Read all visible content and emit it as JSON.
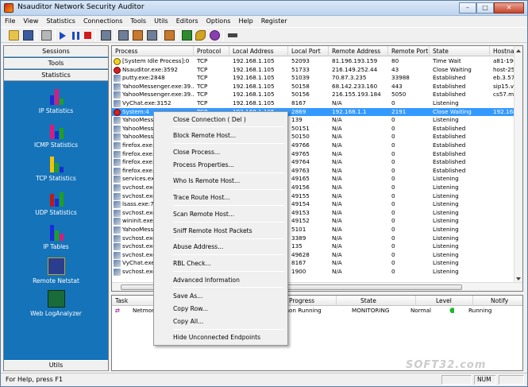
{
  "window": {
    "title": "Nsauditor Network Security Auditor",
    "buttons": [
      "–",
      "□",
      "✕"
    ]
  },
  "menu": [
    "File",
    "View",
    "Statistics",
    "Connections",
    "Tools",
    "Utils",
    "Editors",
    "Options",
    "Help",
    "Register"
  ],
  "left": {
    "tabs": {
      "sessions": "Sessions",
      "tools": "Tools",
      "statistics": "Statistics",
      "utils": "Utils"
    },
    "items": [
      {
        "label": "IP Statistics",
        "icon": "ip-statistics-icon"
      },
      {
        "label": "ICMP Statistics",
        "icon": "icmp-statistics-icon"
      },
      {
        "label": "TCP Statistics",
        "icon": "tcp-statistics-icon"
      },
      {
        "label": "UDP Statistics",
        "icon": "udp-statistics-icon"
      },
      {
        "label": "IP Tables",
        "icon": "ip-tables-icon"
      },
      {
        "label": "Remote Netstat",
        "icon": "remote-netstat-icon"
      },
      {
        "label": "Web LogAnalyzer",
        "icon": "web-loganalyzer-icon"
      }
    ]
  },
  "table": {
    "columns": [
      "Process",
      "Protocol",
      "Local Address",
      "Local Port",
      "Remote Address",
      "Remote Port",
      "State",
      "Hostnam"
    ],
    "rows": [
      [
        "[System Idle Process]:0",
        "TCP",
        "192.168.1.105",
        "52093",
        "81.196.193.159",
        "80",
        "Time Wait",
        "a81-196"
      ],
      [
        "Nsauditor.exe:3592",
        "TCP",
        "192.168.1.105",
        "51733",
        "216.149.252.44",
        "43",
        "Close Waiting",
        "host-252"
      ],
      [
        "putty.exe:2848",
        "TCP",
        "192.168.1.105",
        "51039",
        "70.87.3.235",
        "33988",
        "Established",
        "eb.3.574"
      ],
      [
        "YahooMessenger.exe:39...",
        "TCP",
        "192.168.1.105",
        "50158",
        "68.142.233.160",
        "443",
        "Established",
        "sip15.vo"
      ],
      [
        "YahooMessenger.exe:39...",
        "TCP",
        "192.168.1.105",
        "50156",
        "216.155.193.184",
        "5050",
        "Established",
        "cs57.ms"
      ],
      [
        "VyChat.exe:3152",
        "TCP",
        "192.168.1.105",
        "8167",
        "N/A",
        "0",
        "Listening",
        ""
      ],
      [
        "System:4",
        "TCP",
        "192.168.1.105",
        "2869",
        "192.168.1.1",
        "2191",
        "Close Waiting",
        "192.168"
      ],
      [
        "YahooMessenger.exe",
        "",
        "",
        "139",
        "N/A",
        "0",
        "Listening",
        ""
      ],
      [
        "YahooMessenger.exe",
        "",
        "",
        "50151",
        "N/A",
        "0",
        "Established",
        ""
      ],
      [
        "YahooMessenger.exe",
        "",
        "",
        "50150",
        "N/A",
        "0",
        "Established",
        ""
      ],
      [
        "firefox.exe:1",
        "",
        "",
        "49766",
        "N/A",
        "0",
        "Established",
        ""
      ],
      [
        "firefox.exe:1",
        "",
        "",
        "49765",
        "N/A",
        "0",
        "Established",
        ""
      ],
      [
        "firefox.exe:1",
        "",
        "",
        "49764",
        "N/A",
        "0",
        "Established",
        ""
      ],
      [
        "firefox.exe:1",
        "",
        "",
        "49763",
        "N/A",
        "0",
        "Established",
        ""
      ],
      [
        "services.exe",
        "",
        "",
        "49165",
        "N/A",
        "0",
        "Listening",
        ""
      ],
      [
        "svchost.exe",
        "",
        "",
        "49156",
        "N/A",
        "0",
        "Listening",
        ""
      ],
      [
        "svchost.exe",
        "",
        "",
        "49155",
        "N/A",
        "0",
        "Listening",
        ""
      ],
      [
        "lsass.exe:7",
        "",
        "",
        "49154",
        "N/A",
        "0",
        "Listening",
        ""
      ],
      [
        "svchost.exe",
        "",
        "",
        "49153",
        "N/A",
        "0",
        "Listening",
        ""
      ],
      [
        "wininit.exe:6",
        "",
        "",
        "49152",
        "N/A",
        "0",
        "Listening",
        ""
      ],
      [
        "YahooMessenger.exe",
        "",
        "",
        "5101",
        "N/A",
        "0",
        "Listening",
        ""
      ],
      [
        "svchost.exe",
        "",
        "",
        "3389",
        "N/A",
        "0",
        "Listening",
        ""
      ],
      [
        "svchost.exe",
        "",
        "",
        "135",
        "N/A",
        "0",
        "Listening",
        ""
      ],
      [
        "svchost.exe",
        "",
        "",
        "49628",
        "N/A",
        "0",
        "Listening",
        ""
      ],
      [
        "VyChat.exe",
        "",
        "",
        "8167",
        "N/A",
        "0",
        "Listening",
        ""
      ],
      [
        "svchost.exe",
        "",
        "",
        "1900",
        "N/A",
        "0",
        "Listening",
        ""
      ]
    ]
  },
  "bottom": {
    "columns": [
      "Task",
      "Progress",
      "State",
      "Level",
      "Notify"
    ],
    "row": {
      "task": "Netmon",
      "progress": "mon Running",
      "state": "MONITORING",
      "level": "Normal",
      "notify": "Running"
    }
  },
  "context_menu": [
    "Close Connection ( Del )",
    "Block Remote Host...",
    "Close Process...",
    "Process Properties...",
    "Who Is Remote Host...",
    "Trace Route Host...",
    "Scan Remote Host...",
    "Sniff Remote Host Packets",
    "Abuse Address...",
    "RBL Check...",
    "Advanced Information",
    "Save As...",
    "Copy Row...",
    "Copy All...",
    "Hide Unconnected Endpoints"
  ],
  "status": {
    "help": "For Help, press F1",
    "num": "NUM"
  },
  "watermark": "SOFT32.com"
}
